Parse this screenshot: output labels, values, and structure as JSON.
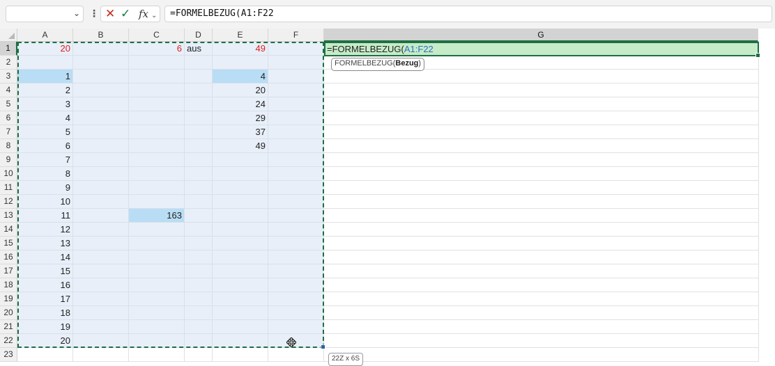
{
  "formula_bar": {
    "name_box_value": "",
    "cancel_label": "✕",
    "enter_label": "✓",
    "fx_label": "fx",
    "formula": "=FORMELBEZUG(A1:F22"
  },
  "grid": {
    "columns": [
      "A",
      "B",
      "C",
      "D",
      "E",
      "F",
      "G"
    ],
    "rows": [
      "1",
      "2",
      "3",
      "4",
      "5",
      "6",
      "7",
      "8",
      "9",
      "10",
      "11",
      "12",
      "13",
      "14",
      "15",
      "16",
      "17",
      "18",
      "19",
      "20",
      "21",
      "22",
      "23"
    ],
    "active_column": "G",
    "active_row": "1",
    "cells": {
      "A1": "20",
      "C1": "6",
      "D1": "aus",
      "E1": "49",
      "A3": "1",
      "A4": "2",
      "A5": "3",
      "A6": "4",
      "A7": "5",
      "A8": "6",
      "A9": "7",
      "A10": "8",
      "A11": "9",
      "A12": "10",
      "A13": "11",
      "A14": "12",
      "A15": "13",
      "A16": "14",
      "A17": "15",
      "A18": "16",
      "A19": "17",
      "A20": "18",
      "A21": "19",
      "A22": "20",
      "C13": "163",
      "E3": "4",
      "E4": "20",
      "E5": "24",
      "E6": "29",
      "E7": "37",
      "E8": "49"
    },
    "highlighted_cells": [
      "A3",
      "E3",
      "C13"
    ],
    "red_text_cells": [
      "A1",
      "C1",
      "E1"
    ]
  },
  "editing_cell": {
    "address": "G1",
    "prefix": "=FORMELBEZUG(",
    "reference": "A1:F22"
  },
  "tooltip": {
    "function_name": "FORMELBEZUG",
    "open_paren": "(",
    "argument": "Bezug",
    "close_paren": ")"
  },
  "selection_size_tip": "22Z x 6S",
  "colors": {
    "accent_green": "#1e6e42",
    "reference_blue": "#2f6fc0",
    "selection_fill": "#e8eff9",
    "highlight_fill": "#b9ddf5",
    "red_text": "#e0201b",
    "active_cell_fill": "#c5ebc8"
  }
}
